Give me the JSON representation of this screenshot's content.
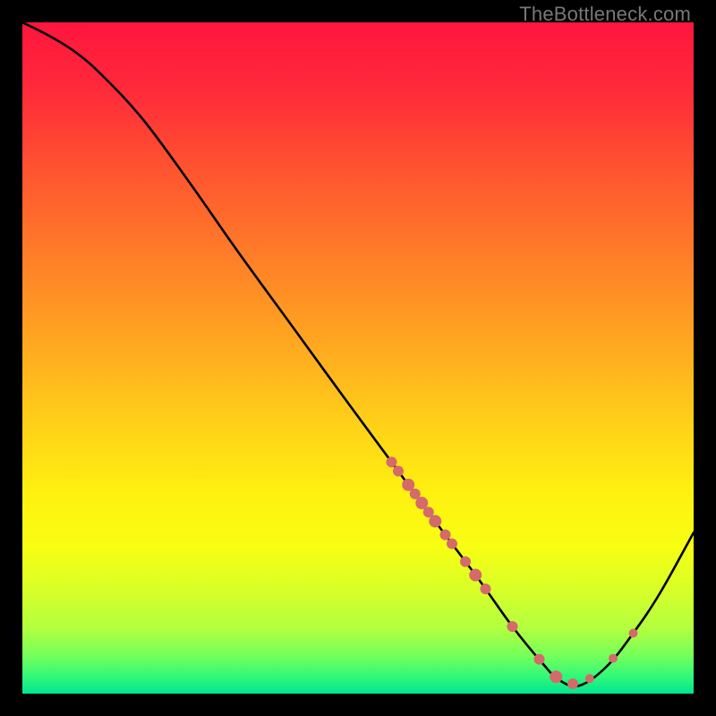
{
  "watermark": "TheBottleneck.com",
  "colors": {
    "dot": "#d46a6a",
    "curve": "#000000",
    "gradient_stops": [
      {
        "offset": 0.0,
        "color": "#ff153e"
      },
      {
        "offset": 0.1,
        "color": "#ff2a3a"
      },
      {
        "offset": 0.22,
        "color": "#ff5430"
      },
      {
        "offset": 0.35,
        "color": "#ff7e28"
      },
      {
        "offset": 0.48,
        "color": "#ffa820"
      },
      {
        "offset": 0.6,
        "color": "#ffd118"
      },
      {
        "offset": 0.7,
        "color": "#fff010"
      },
      {
        "offset": 0.78,
        "color": "#f8fe12"
      },
      {
        "offset": 0.85,
        "color": "#d6ff2a"
      },
      {
        "offset": 0.905,
        "color": "#b0ff40"
      },
      {
        "offset": 0.945,
        "color": "#72ff5c"
      },
      {
        "offset": 0.975,
        "color": "#30f87a"
      },
      {
        "offset": 1.0,
        "color": "#00e690"
      }
    ]
  },
  "chart_data": {
    "type": "line",
    "title": "",
    "xlabel": "",
    "ylabel": "",
    "xlim": [
      0,
      100
    ],
    "ylim": [
      0,
      100
    ],
    "series": [
      {
        "name": "bottleneck-curve",
        "x": [
          0,
          4,
          8,
          12,
          18,
          25,
          32,
          40,
          48,
          55,
          62,
          68,
          73,
          77.5,
          80,
          83,
          87,
          91,
          95,
          100
        ],
        "y": [
          100,
          98,
          95.5,
          92,
          85.5,
          76,
          66,
          55,
          44,
          34.5,
          25,
          17,
          10,
          4.5,
          2,
          1.2,
          4,
          9,
          15,
          24
        ]
      }
    ],
    "highlight_points": {
      "name": "marked-configs",
      "x": [
        55,
        56,
        57.5,
        58.5,
        59.5,
        60.5,
        61.5,
        63,
        64,
        66,
        67.5,
        69,
        73,
        77,
        79.5,
        82,
        84.5,
        88,
        91
      ],
      "r": [
        6,
        6,
        7,
        6,
        7,
        6,
        7,
        6,
        6,
        6,
        7,
        6,
        6,
        6,
        7,
        6,
        5,
        5,
        5
      ]
    }
  }
}
